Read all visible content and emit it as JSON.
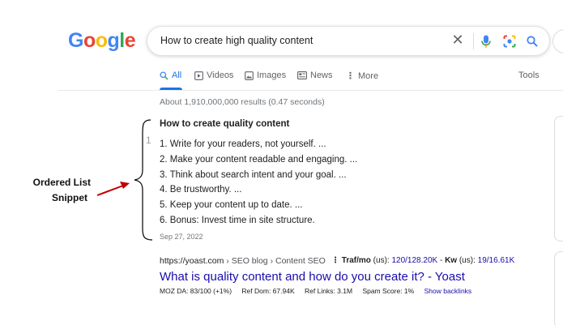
{
  "logo": [
    "G",
    "o",
    "o",
    "g",
    "l",
    "e"
  ],
  "search": {
    "query": "How to create high quality content"
  },
  "tabs": {
    "all": "All",
    "videos": "Videos",
    "images": "Images",
    "news": "News",
    "more": "More",
    "tools": "Tools"
  },
  "result_stats": "About 1,910,000,000 results (0.47 seconds)",
  "snippet": {
    "title": "How to create quality content",
    "marker": "1",
    "items": [
      "1. Write for your readers, not yourself. ...",
      "2. Make your content readable and engaging. ...",
      "3. Think about search intent and your goal. ...",
      "4. Be trustworthy. ...",
      "5. Keep your content up to date. ...",
      "6. Bonus: Invest time in site structure."
    ],
    "date": "Sep 27, 2022"
  },
  "annotation": {
    "line1": "Ordered List",
    "line2": "Snippet",
    "color": "#c00000"
  },
  "result": {
    "url": "https://yoast.com",
    "breadcrumb": " › SEO blog › Content SEO",
    "traf_label": "Traf/mo",
    "traf_scope": " (us): ",
    "traf_value": "120/128.20K",
    "kw_sep": " - ",
    "kw_label": "Kw",
    "kw_scope": " (us): ",
    "kw_value": "19/16.61K",
    "title": "What is quality content and how do you create it? - Yoast",
    "moz_da": "MOZ DA: 83/100 (+1%)",
    "ref_dom": "Ref Dom: 67.94K",
    "ref_links": "Ref Links: 3.1M",
    "spam": "Spam Score: 1%",
    "backlinks": "Show backlinks"
  },
  "colors": {
    "link": "#1a0dab",
    "accent": "#1a73e8",
    "meta": "#70757a"
  }
}
